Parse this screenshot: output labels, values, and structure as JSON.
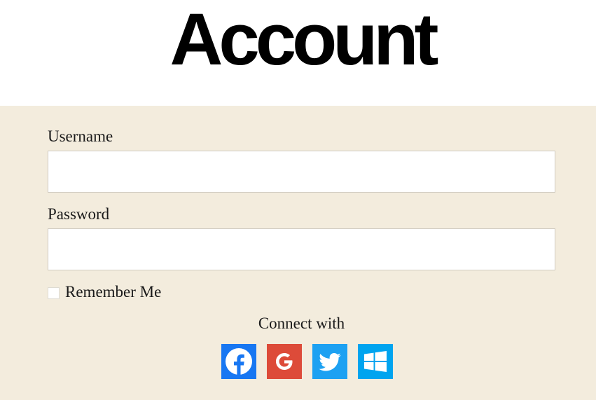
{
  "page": {
    "title": "Account"
  },
  "form": {
    "username_label": "Username",
    "username_value": "",
    "password_label": "Password",
    "password_value": "",
    "remember_label": "Remember Me",
    "remember_checked": false
  },
  "social": {
    "heading": "Connect with",
    "providers": [
      {
        "name": "Facebook",
        "icon": "facebook-icon",
        "color": "#1877f2"
      },
      {
        "name": "Google",
        "icon": "google-icon",
        "color": "#dd4b39"
      },
      {
        "name": "Twitter",
        "icon": "twitter-icon",
        "color": "#1da1f2"
      },
      {
        "name": "Windows",
        "icon": "windows-icon",
        "color": "#00a4ef"
      }
    ]
  },
  "colors": {
    "panel_background": "#f3ecdd",
    "text": "#1a1a1a"
  }
}
